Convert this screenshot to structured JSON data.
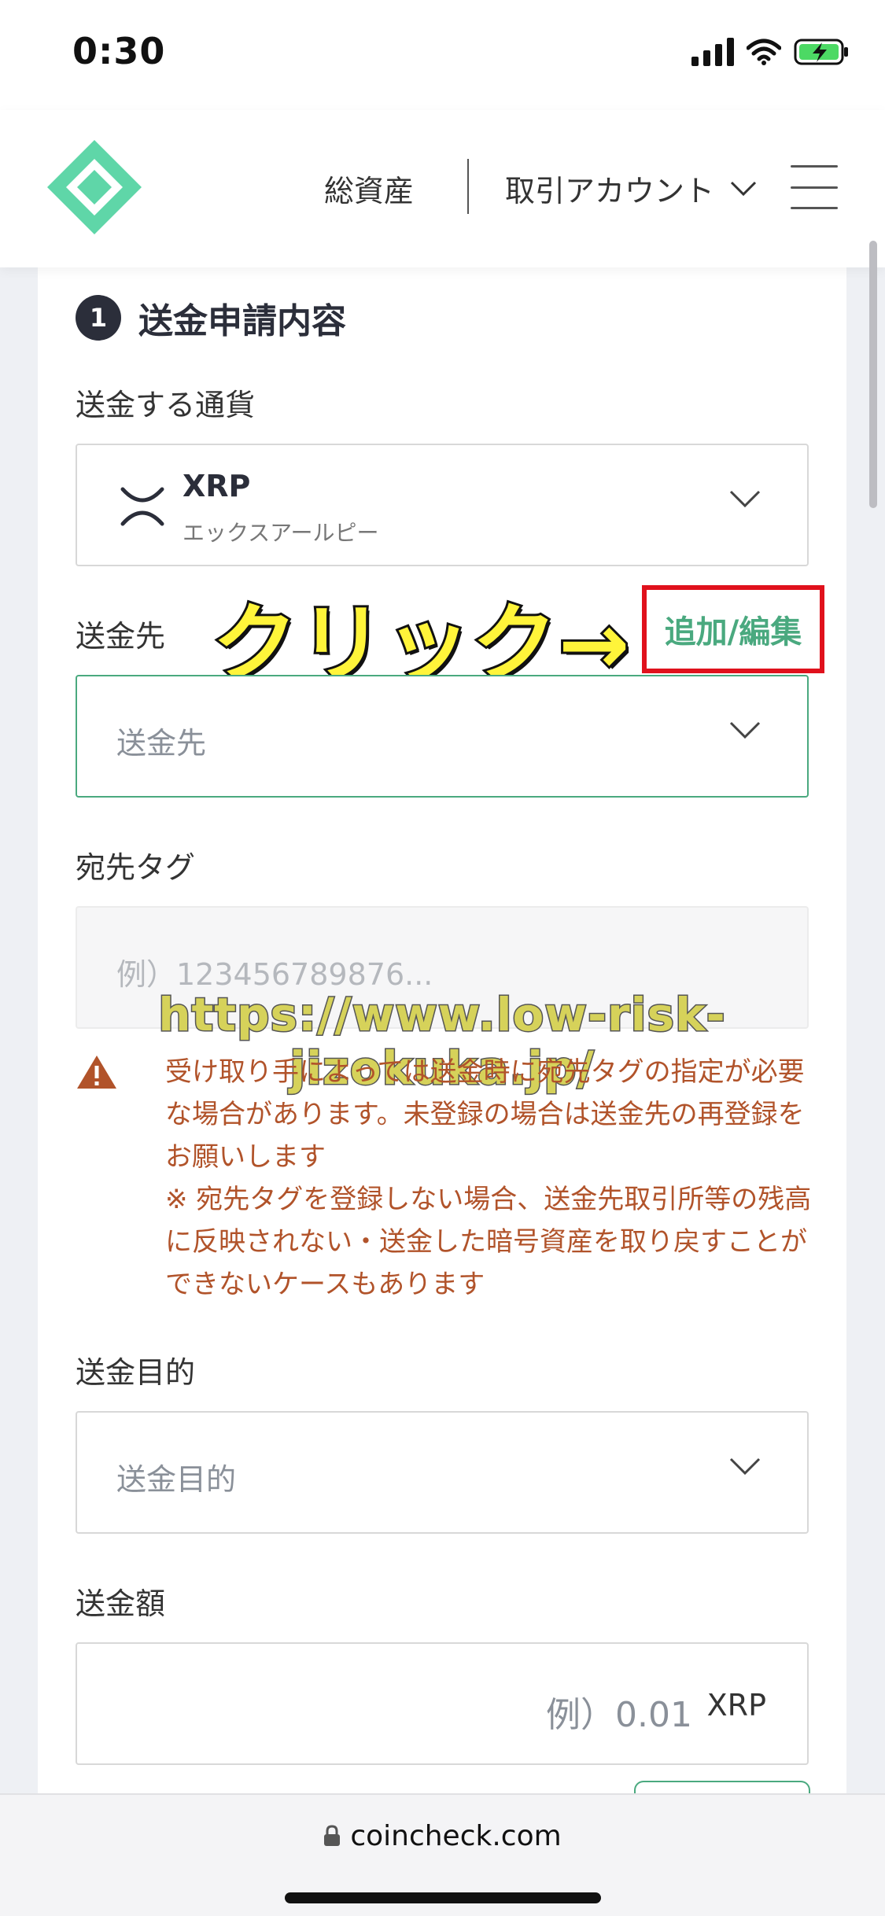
{
  "status_bar": {
    "time": "0:30"
  },
  "header": {
    "assets_label": "総資産",
    "account_label": "取引アカウント"
  },
  "section": {
    "step_number": "1",
    "title": "送金申請内容"
  },
  "currency": {
    "label": "送金する通貨",
    "code": "XRP",
    "name": "エックスアールピー"
  },
  "destination": {
    "label": "送金先",
    "add_edit_label": "追加/編集",
    "placeholder": "送金先"
  },
  "annotation": {
    "click_text": "クリック→",
    "watermark": "https://www.low-risk-jizokuka.jp/"
  },
  "destination_tag": {
    "label": "宛先タグ",
    "placeholder": "例）123456789876..."
  },
  "warning": {
    "line1": "受け取り手によっては送金時に宛先タグの指定が必要な場合があります。未登録の場合は送金先の再登録をお願いします",
    "line2": "※ 宛先タグを登録しない場合、送金先取引所等の残高に反映されない・送金した暗号資産を取り戻すことができないケースもあります"
  },
  "purpose": {
    "label": "送金目的",
    "placeholder": "送金目的"
  },
  "amount": {
    "label": "送金額",
    "placeholder": "例）0.01",
    "unit": "XRP"
  },
  "browser": {
    "url": "coincheck.com"
  },
  "colors": {
    "brand_green": "#4aa97f",
    "warning_text": "#b1532a",
    "highlight_red": "#e0111c",
    "annotation_yellow": "#fff43a"
  }
}
